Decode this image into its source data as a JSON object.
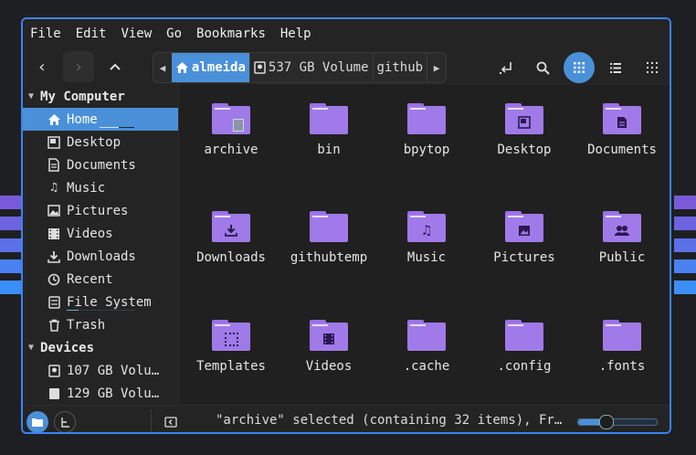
{
  "menu": [
    "File",
    "Edit",
    "View",
    "Go",
    "Bookmarks",
    "Help"
  ],
  "toolbar": {
    "back_icon": "chevron-left",
    "forward_icon": "chevron-right",
    "up_icon": "chevron-up",
    "path": [
      "almeida",
      "537 GB Volume",
      "github"
    ],
    "accent": "#4a90d9"
  },
  "sidebar": {
    "sections": [
      {
        "title": "My Computer",
        "items": [
          {
            "label": "Home",
            "icon": "home-icon",
            "active": true,
            "usage": 0.55
          },
          {
            "label": "Desktop",
            "icon": "desktop-icon"
          },
          {
            "label": "Documents",
            "icon": "document-icon"
          },
          {
            "label": "Music",
            "icon": "music-icon"
          },
          {
            "label": "Pictures",
            "icon": "picture-icon"
          },
          {
            "label": "Videos",
            "icon": "video-icon"
          },
          {
            "label": "Downloads",
            "icon": "download-icon"
          },
          {
            "label": "Recent",
            "icon": "clock-icon"
          },
          {
            "label": "File System",
            "icon": "drive-icon",
            "usage": 0.18
          },
          {
            "label": "Trash",
            "icon": "trash-icon"
          }
        ]
      },
      {
        "title": "Devices",
        "items": [
          {
            "label": "107 GB Volu…",
            "icon": "drive-icon"
          },
          {
            "label": "129 GB Volu…",
            "icon": "drive-icon"
          }
        ]
      }
    ]
  },
  "files": [
    {
      "name": "archive",
      "emblem": "archive"
    },
    {
      "name": "bin",
      "emblem": ""
    },
    {
      "name": "bpytop",
      "emblem": ""
    },
    {
      "name": "Desktop",
      "emblem": "desktop"
    },
    {
      "name": "Documents",
      "emblem": "document"
    },
    {
      "name": "Downloads",
      "emblem": "download"
    },
    {
      "name": "githubtemp",
      "emblem": ""
    },
    {
      "name": "Music",
      "emblem": "music"
    },
    {
      "name": "Pictures",
      "emblem": "picture"
    },
    {
      "name": "Public",
      "emblem": "people"
    },
    {
      "name": "Templates",
      "emblem": "template"
    },
    {
      "name": "Videos",
      "emblem": "video"
    },
    {
      "name": ".cache",
      "emblem": ""
    },
    {
      "name": ".config",
      "emblem": ""
    },
    {
      "name": ".fonts",
      "emblem": ""
    }
  ],
  "status": {
    "text": "\"archive\" selected (containing 32 items), Fr…",
    "zoom_level": 0.35
  },
  "colors": {
    "folder": "#a07ae8",
    "stripes": [
      "#7b5ad9",
      "#6d63e0",
      "#5c70e8",
      "#4a80f0",
      "#3b8ef5"
    ]
  }
}
